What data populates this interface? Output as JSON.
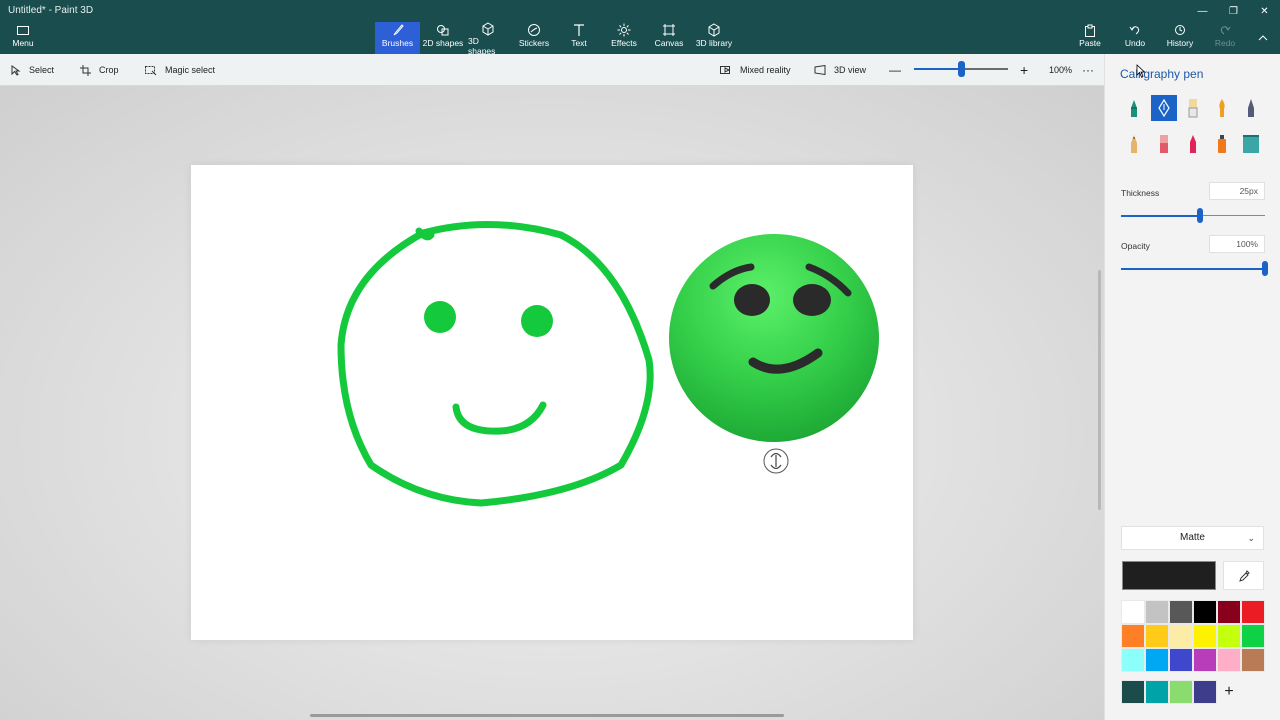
{
  "app": {
    "title": "Untitled* - Paint 3D"
  },
  "ribbon": {
    "menu": "Menu",
    "tabs": [
      {
        "label": "Brushes",
        "icon": "brush-icon",
        "active": true
      },
      {
        "label": "2D shapes",
        "icon": "2d-shapes-icon"
      },
      {
        "label": "3D shapes",
        "icon": "3d-shapes-icon"
      },
      {
        "label": "Stickers",
        "icon": "stickers-icon"
      },
      {
        "label": "Text",
        "icon": "text-icon"
      },
      {
        "label": "Effects",
        "icon": "effects-icon"
      },
      {
        "label": "Canvas",
        "icon": "canvas-icon"
      },
      {
        "label": "3D library",
        "icon": "3d-library-icon"
      }
    ],
    "actions": {
      "paste": "Paste",
      "undo": "Undo",
      "history": "History",
      "redo": "Redo"
    }
  },
  "toolbar": {
    "select": "Select",
    "crop": "Crop",
    "magic_select": "Magic select",
    "mixed_reality": "Mixed reality",
    "view_3d": "3D view",
    "zoom_percent": "100%",
    "zoom_level": 0.5,
    "more": "···"
  },
  "panel": {
    "title": "Calligraphy pen",
    "brushes": [
      "marker-icon",
      "calligraphy-pen-icon",
      "oil-brush-icon",
      "watercolor-icon",
      "pixel-pen-icon",
      "pencil-icon",
      "eraser-icon",
      "crayon-icon",
      "spray-can-icon",
      "fill-icon"
    ],
    "selected_brush": "calligraphy-pen-icon",
    "thickness_label": "Thickness",
    "thickness_value": "25px",
    "thickness_level": 0.55,
    "opacity_label": "Opacity",
    "opacity_value": "100%",
    "opacity_level": 1.0,
    "finish": "Matte",
    "current_color": "#1f1f1f",
    "palette": [
      "#ffffff",
      "#c3c3c3",
      "#585858",
      "#000000",
      "#88001b",
      "#ec1c24",
      "#ff7f27",
      "#ffca18",
      "#fdeca6",
      "#fff200",
      "#c4ff0e",
      "#0ed145",
      "#8cfffb",
      "#00a8f3",
      "#3f48cc",
      "#b83dba",
      "#ffaec8",
      "#b97a56"
    ],
    "custom_colors": [
      "#1c4b4b",
      "#00a3a8",
      "#8bdc6e",
      "#3d3d8c"
    ]
  },
  "canvas": {
    "drawing_color": "#15c93c",
    "sphere_color": "#3fd84f"
  }
}
